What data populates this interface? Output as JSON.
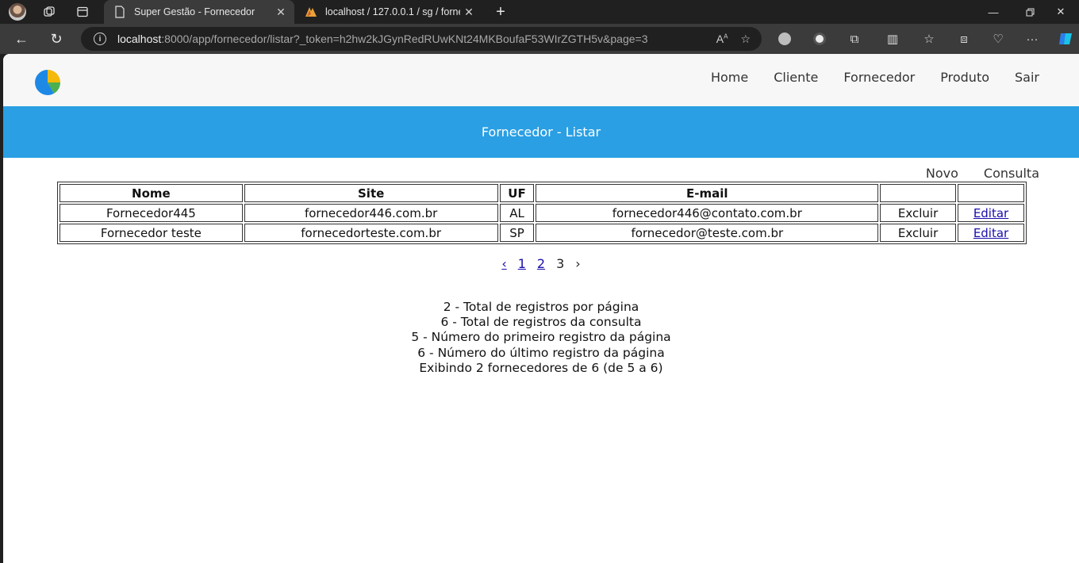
{
  "browser": {
    "tabs": [
      {
        "title": "Super Gestão - Fornecedor",
        "active": true
      },
      {
        "title": "localhost / 127.0.0.1 / sg / fornec",
        "active": false
      }
    ],
    "url": {
      "host": "localhost",
      "rest": ":8000/app/fornecedor/listar?_token=h2hw2kJGynRedRUwKNt24MKBoufaF53WIrZGTH5v&page=3"
    }
  },
  "nav": {
    "items": [
      "Home",
      "Cliente",
      "Fornecedor",
      "Produto",
      "Sair"
    ]
  },
  "page_title": "Fornecedor - Listar",
  "sub_menu": {
    "novo": "Novo",
    "consulta": "Consulta"
  },
  "table": {
    "headers": [
      "Nome",
      "Site",
      "UF",
      "E-mail",
      "",
      ""
    ],
    "rows": [
      {
        "nome": "Fornecedor445",
        "site": "fornecedor446.com.br",
        "uf": "AL",
        "email": "fornecedor446@contato.com.br",
        "excluir": "Excluir",
        "editar": "Editar"
      },
      {
        "nome": "Fornecedor teste",
        "site": "fornecedorteste.com.br",
        "uf": "SP",
        "email": "fornecedor@teste.com.br",
        "excluir": "Excluir",
        "editar": "Editar"
      }
    ]
  },
  "pagination": {
    "prev": "‹",
    "pages": [
      "1",
      "2"
    ],
    "current": "3",
    "next": "›"
  },
  "info_lines": [
    "2 - Total de registros por página",
    "6 - Total de registros da consulta",
    "5 - Número do primeiro registro da página",
    "6 - Número do último registro da página",
    "Exibindo 2 fornecedores de 6 (de 5 a 6)"
  ],
  "colors": {
    "header_bar": "#2a9fe3",
    "top_bg": "#f7f7f7",
    "link": "#1a0dab"
  }
}
